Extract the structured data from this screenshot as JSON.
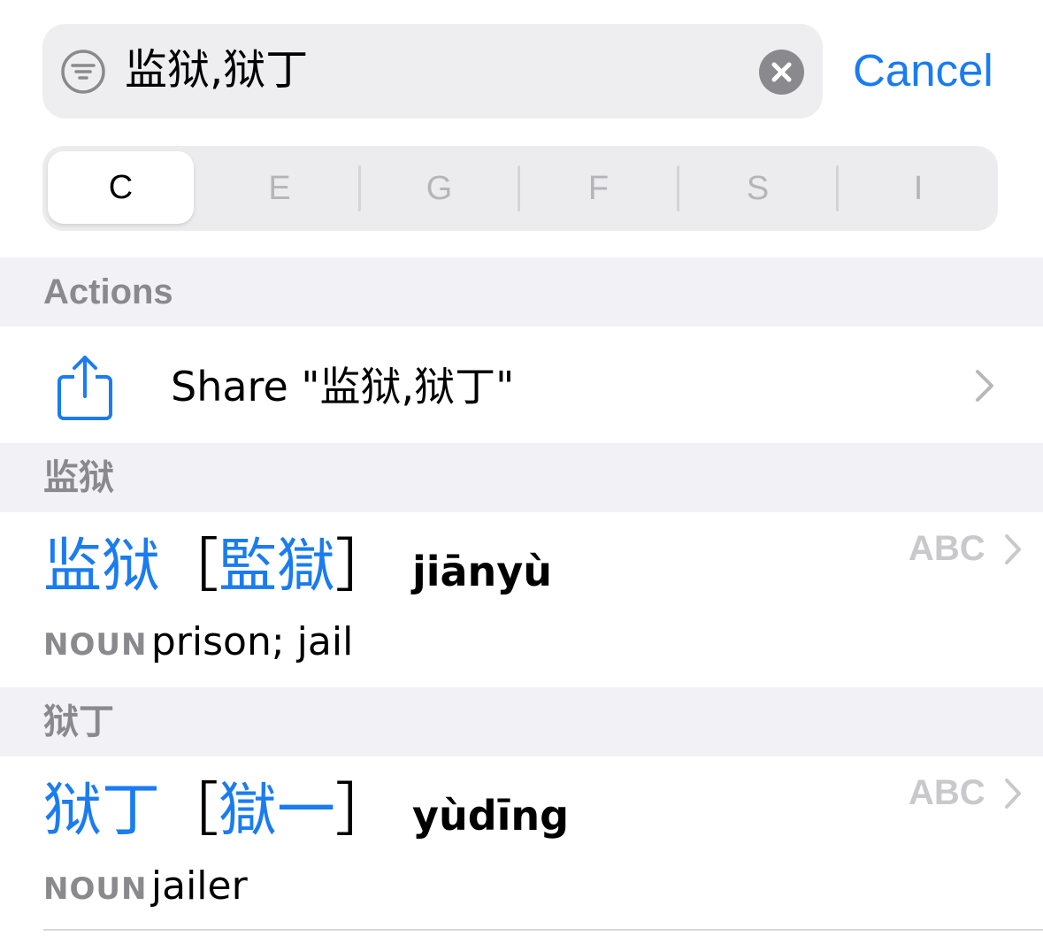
{
  "search": {
    "query": "监狱,狱丁",
    "cancel_label": "Cancel"
  },
  "segments": [
    {
      "label": "C",
      "selected": true
    },
    {
      "label": "E",
      "selected": false
    },
    {
      "label": "G",
      "selected": false
    },
    {
      "label": "F",
      "selected": false
    },
    {
      "label": "S",
      "selected": false
    },
    {
      "label": "I",
      "selected": false
    }
  ],
  "actions": {
    "header": "Actions",
    "share_label": "Share \"监狱,狱丁\""
  },
  "entries": [
    {
      "header": "监狱",
      "simplified": "监狱",
      "bracket_open": "［",
      "traditional": "監獄",
      "bracket_close": "］",
      "pinyin": "jiānyù",
      "pos": "NOUN",
      "gloss": "prison; jail",
      "badge": "ABC"
    },
    {
      "header": "狱丁",
      "simplified": "狱丁",
      "bracket_open": "［",
      "traditional": "獄一",
      "bracket_close": "］",
      "pinyin": "yùdīng",
      "pos": "NOUN",
      "gloss": "jailer",
      "badge": "ABC"
    }
  ],
  "colors": {
    "accent": "#1a7cf0",
    "section_bg": "#f1f1f6",
    "secondary_text": "#8a8a8e"
  },
  "icons": [
    "filter-icon",
    "clear-icon",
    "share-icon",
    "chevron-right-icon"
  ]
}
